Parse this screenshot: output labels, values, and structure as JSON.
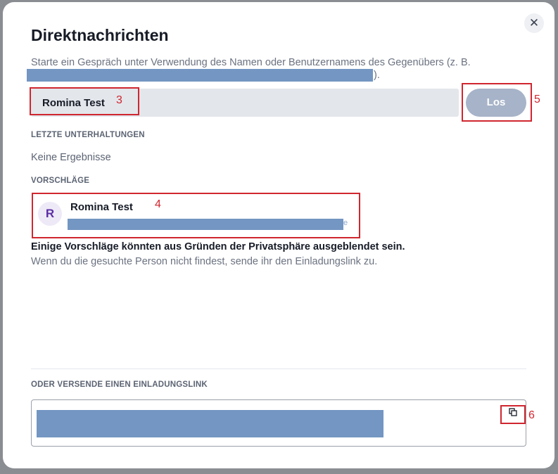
{
  "dialog": {
    "title": "Direktnachrichten",
    "description": "Starte ein Gespräch unter Verwendung des Namen oder Benutzernamens des Gegenübers (z. B.",
    "description_tail": ").",
    "close_icon": "close-icon",
    "close_glyph": "✕"
  },
  "search": {
    "value": "Romina Test",
    "placeholder": "",
    "go_label": "Los"
  },
  "recent": {
    "heading": "LETZTE UNTERHALTUNGEN",
    "empty": "Keine Ergebnisse"
  },
  "suggestions": {
    "heading": "VORSCHLÄGE",
    "items": [
      {
        "initial": "R",
        "name": "Romina Test",
        "tail": "e"
      }
    ]
  },
  "privacy": {
    "note": "Einige Vorschläge könnten aus Gründen der Privatsphäre ausgeblendet sein.",
    "hint": "Wenn du die gesuchte Person nicht findest, sende ihr den Einladungslink zu."
  },
  "invite": {
    "heading": "ODER VERSENDE EINEN EINLADUNGSLINK",
    "copy_icon": "copy-icon"
  },
  "annotations": {
    "a3": "3",
    "a4": "4",
    "a5": "5",
    "a6": "6"
  },
  "colors": {
    "annotation": "#d0262f",
    "redaction": "#7396c2",
    "go_button": "#a6b3c8",
    "avatar_text": "#5b2ea6"
  }
}
